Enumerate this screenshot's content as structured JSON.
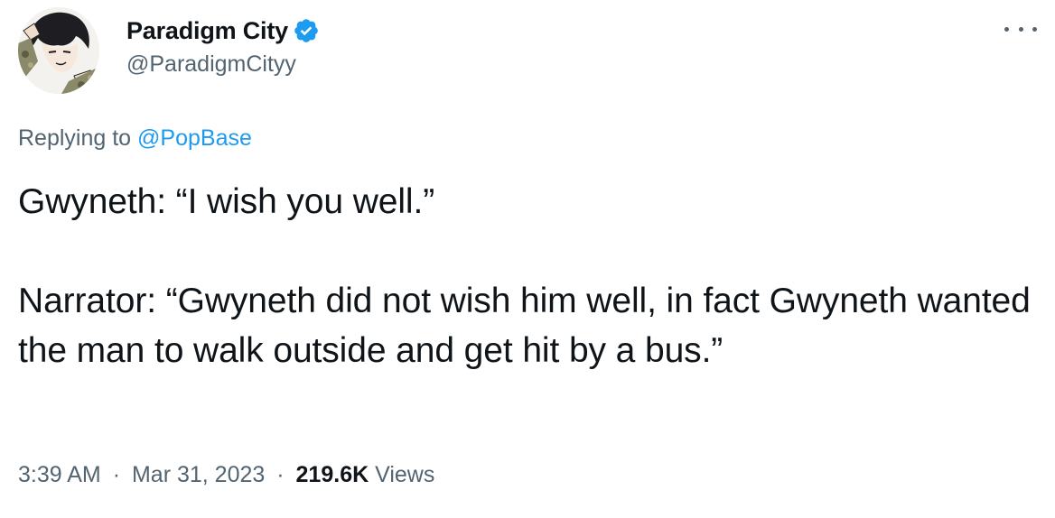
{
  "author": {
    "display_name": "Paradigm City",
    "handle": "@ParadigmCityy",
    "verified": true,
    "avatar_icon": "anime-character-avatar"
  },
  "reply": {
    "prefix": "Replying to",
    "mention": "@PopBase"
  },
  "tweet": {
    "paragraphs": [
      "Gwyneth: “I wish you well.”",
      "Narrator: “Gwyneth did not wish him well, in fact Gwyneth wanted the man to walk outside and get hit by a bus.”"
    ]
  },
  "meta": {
    "time": "3:39 AM",
    "separator": "·",
    "date": "Mar 31, 2023",
    "views_count": "219.6K",
    "views_label": "Views"
  },
  "colors": {
    "text_primary": "#0f1419",
    "text_secondary": "#536471",
    "link": "#1d9bf0",
    "verified_badge": "#1d9bf0"
  },
  "icons": {
    "verified": "verified-badge-icon",
    "more": "more-horizontal-icon"
  }
}
